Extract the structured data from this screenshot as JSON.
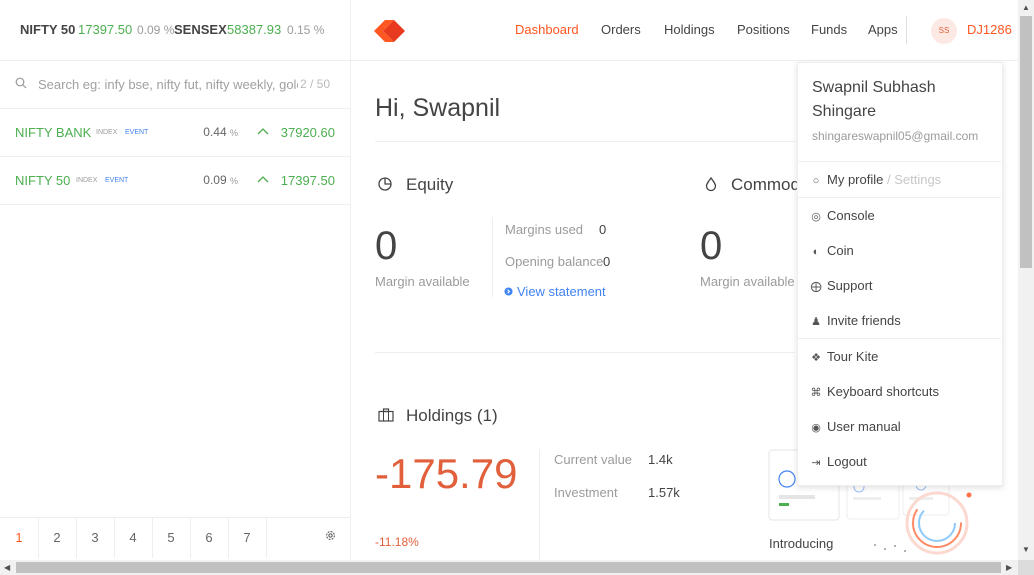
{
  "indices": [
    {
      "name": "NIFTY 50",
      "value": "17397.50",
      "change": "0.09 %"
    },
    {
      "name": "SENSEX",
      "value": "58387.93",
      "change": "0.15 %"
    }
  ],
  "nav": {
    "items": [
      "Dashboard",
      "Orders",
      "Holdings",
      "Positions",
      "Funds",
      "Apps"
    ],
    "active": "Dashboard",
    "avatar_initials": "SS",
    "user_id": "DJ1286"
  },
  "search": {
    "placeholder": "Search eg: infy bse, nifty fut, nifty weekly, gold mcx",
    "count": "2 / 50"
  },
  "watchlist": [
    {
      "name": "NIFTY BANK",
      "tag1": "INDEX",
      "tag2": "EVENT",
      "change": "0.44",
      "pct": "%",
      "ltp": "37920.60"
    },
    {
      "name": "NIFTY 50",
      "tag1": "INDEX",
      "tag2": "EVENT",
      "change": "0.09",
      "pct": "%",
      "ltp": "17397.50"
    }
  ],
  "pages": [
    "1",
    "2",
    "3",
    "4",
    "5",
    "6",
    "7"
  ],
  "main": {
    "greeting": "Hi, Swapnil",
    "equity": {
      "title": "Equity",
      "margin_available": "0",
      "margin_available_label": "Margin available",
      "margins_used_label": "Margins used",
      "margins_used": "0",
      "opening_balance_label": "Opening balance",
      "opening_balance": "0",
      "view_statement": "View statement"
    },
    "commodity": {
      "title": "Commodity",
      "margin_available": "0",
      "margin_available_label": "Margin available"
    },
    "holdings": {
      "title": "Holdings (1)",
      "pnl": "-175.79",
      "pnl_pct": "-11.18%",
      "current_value_label": "Current value",
      "current_value": "1.4k",
      "investment_label": "Investment",
      "investment": "1.57k"
    },
    "introducing": "Introducing"
  },
  "dropdown": {
    "name": "Swapnil Subhash Shingare",
    "email": "shingareswapnil05@gmail.com",
    "profile": "My profile",
    "settings": "/ Settings",
    "items_group1": [
      "Console",
      "Coin",
      "Support",
      "Invite friends"
    ],
    "items_group2": [
      "Tour Kite",
      "Keyboard shortcuts",
      "User manual",
      "Logout"
    ]
  },
  "colors": {
    "accent": "#ff5722",
    "positive": "#4caf50",
    "negative": "#e25f3b",
    "link": "#4184f3"
  }
}
